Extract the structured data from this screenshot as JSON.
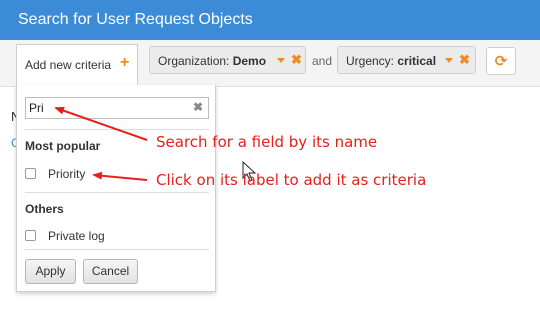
{
  "header": {
    "title": "Search for User Request Objects"
  },
  "criteria_bar": {
    "add_label": "Add new criteria",
    "chips": [
      {
        "field": "Organization:",
        "value": "Demo"
      },
      {
        "field": "Urgency:",
        "value": "critical"
      }
    ],
    "joiner": "and"
  },
  "background": {
    "n": "N",
    "c": "C"
  },
  "popup": {
    "search_value": "Pri",
    "group_popular": "Most popular",
    "popular_items": [
      {
        "label": "Priority",
        "checked": false
      }
    ],
    "group_others": "Others",
    "other_items": [
      {
        "label": "Private log",
        "checked": false
      }
    ],
    "apply_label": "Apply",
    "cancel_label": "Cancel"
  },
  "annotations": {
    "search_hint": "Search for a field by its name",
    "label_hint": "Click on its label to add it as criteria"
  },
  "colors": {
    "header": "#3c8bd6",
    "accent": "#f08a24",
    "callout": "#e8201a"
  },
  "icons": {
    "plus": "plus-icon",
    "caret": "caret-down-icon",
    "remove": "close-icon",
    "refresh": "refresh-icon",
    "clear": "clear-icon",
    "pointer": "mouse-pointer-icon"
  }
}
